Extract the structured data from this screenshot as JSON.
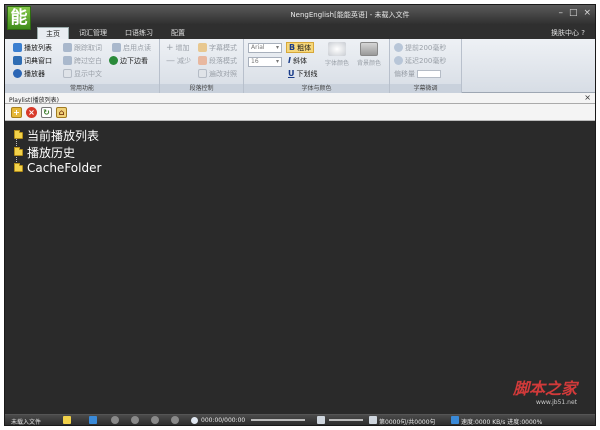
{
  "window": {
    "logo_char": "能",
    "title": "NengEnglish[能能英语] - 未载入文件",
    "controls": [
      "–",
      "□",
      "×"
    ]
  },
  "tabs": [
    {
      "label": "主页",
      "active": true
    },
    {
      "label": "词汇管理",
      "active": false
    },
    {
      "label": "口语练习",
      "active": false
    },
    {
      "label": "配置",
      "active": false
    }
  ],
  "skin_center": "换肤中心",
  "ribbon": {
    "common": {
      "label": "常用功能",
      "buttons": [
        {
          "label": "播放列表",
          "enabled": true
        },
        {
          "label": "跟踪取词",
          "enabled": false
        },
        {
          "label": "启用点读",
          "enabled": false
        },
        {
          "label": "词典窗口",
          "enabled": true
        },
        {
          "label": "跨过空白",
          "enabled": false
        },
        {
          "label": "边下边看",
          "enabled": true
        },
        {
          "label": "播放器",
          "enabled": true
        },
        {
          "label": "显示中文",
          "enabled": false
        }
      ]
    },
    "segment": {
      "label": "段落控制",
      "buttons": [
        {
          "label": "增加",
          "enabled": false
        },
        {
          "label": "字幕模式",
          "enabled": false
        },
        {
          "label": "减少",
          "enabled": false
        },
        {
          "label": "段落模式",
          "enabled": false
        },
        {
          "label": "遍改对照",
          "enabled": false
        }
      ]
    },
    "font": {
      "label": "字体与颜色",
      "font_name": "Arial",
      "font_size": "16",
      "bold": "粗体",
      "italic": "斜体",
      "underline": "下划线",
      "font_color": "字体颜色",
      "bg_color": "背景颜色"
    },
    "subtitle": {
      "label": "字幕微调",
      "advance": "提前200毫秒",
      "delay": "延迟200毫秒",
      "offset_label": "偏移量"
    }
  },
  "playlist": {
    "title": "Playlist(播放列表)",
    "items": [
      "当前播放列表",
      "播放历史",
      "CacheFolder"
    ]
  },
  "watermark": {
    "text": "脚本之家",
    "url": "www.jb51.net"
  },
  "status": {
    "file": "未载入文件",
    "time": "000:00/000:00",
    "sentence": "第0000句/共0000句",
    "speed": "速度:0000 KB/s 进度:0000%"
  },
  "colors": {
    "panel_bg": "#2a2a2a",
    "ribbon_bg": "#e4e9ef",
    "title_bg": "#3a3a3a",
    "folder": "#f2d24a"
  }
}
